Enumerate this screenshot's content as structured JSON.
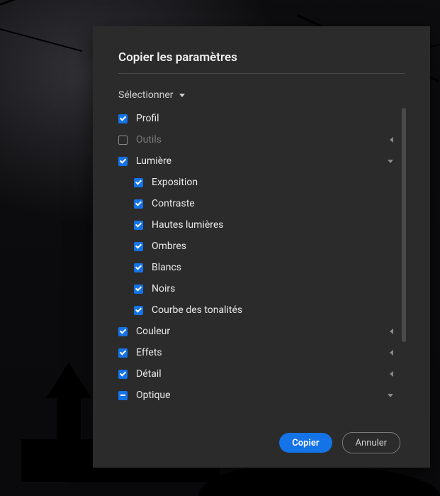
{
  "dialog": {
    "title": "Copier les paramètres",
    "select_label": "Sélectionner",
    "copy_label": "Copier",
    "cancel_label": "Annuler"
  },
  "items": [
    {
      "name": "profil",
      "label": "Profil",
      "state": "checked",
      "expand": null,
      "sub": false
    },
    {
      "name": "outils",
      "label": "Outils",
      "state": "unchecked",
      "expand": "left",
      "sub": false,
      "disabled": true
    },
    {
      "name": "lumiere",
      "label": "Lumière",
      "state": "checked",
      "expand": "down",
      "sub": false
    },
    {
      "name": "exposition",
      "label": "Exposition",
      "state": "checked",
      "expand": null,
      "sub": true
    },
    {
      "name": "contraste",
      "label": "Contraste",
      "state": "checked",
      "expand": null,
      "sub": true
    },
    {
      "name": "hautes-lumieres",
      "label": "Hautes lumières",
      "state": "checked",
      "expand": null,
      "sub": true
    },
    {
      "name": "ombres",
      "label": "Ombres",
      "state": "checked",
      "expand": null,
      "sub": true
    },
    {
      "name": "blancs",
      "label": "Blancs",
      "state": "checked",
      "expand": null,
      "sub": true
    },
    {
      "name": "noirs",
      "label": "Noirs",
      "state": "checked",
      "expand": null,
      "sub": true
    },
    {
      "name": "courbe-tonalites",
      "label": "Courbe des tonalités",
      "state": "checked",
      "expand": null,
      "sub": true
    },
    {
      "name": "couleur",
      "label": "Couleur",
      "state": "checked",
      "expand": "left",
      "sub": false
    },
    {
      "name": "effets",
      "label": "Effets",
      "state": "checked",
      "expand": "left",
      "sub": false
    },
    {
      "name": "detail",
      "label": "Détail",
      "state": "checked",
      "expand": "left",
      "sub": false
    },
    {
      "name": "optique",
      "label": "Optique",
      "state": "partial",
      "expand": "down",
      "sub": false
    }
  ]
}
